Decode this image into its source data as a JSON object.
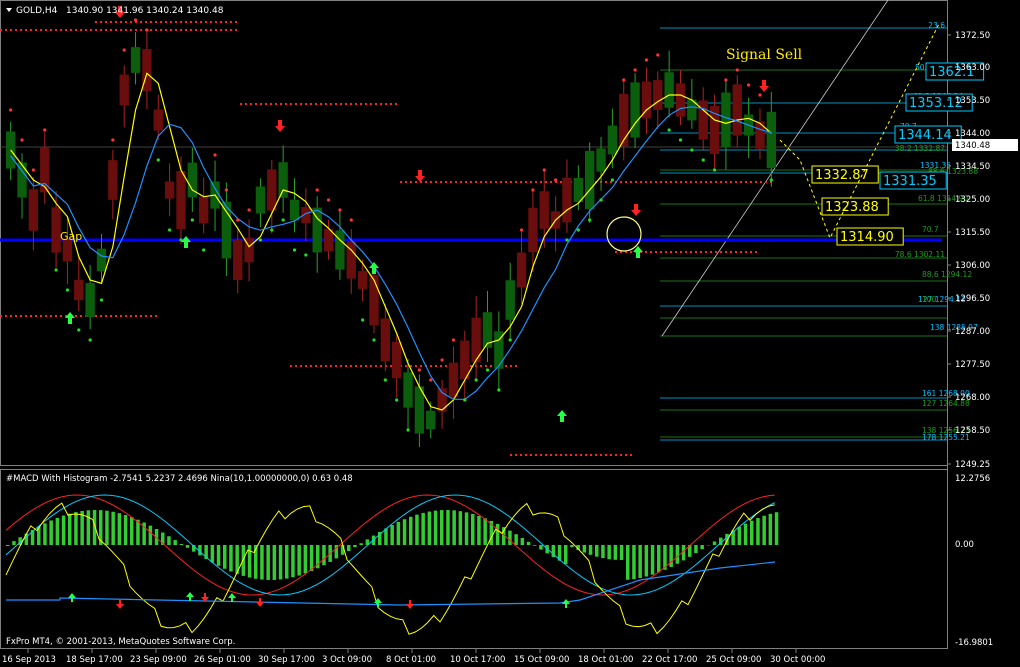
{
  "header": {
    "symbol": "GOLD,H4",
    "ohlc": "1340.90 1341.96 1340.24 1340.48"
  },
  "colors": {
    "background": "#000000",
    "bull_candle": "#0b5e0b",
    "bear_candle": "#6a0d0d",
    "ma_yellow": "#ffff00",
    "ma_cyan": "#1e90ff",
    "psar_green": "#22dd22",
    "psar_red": "#ff3333",
    "support_line": "#0000ff",
    "level_red": "#ff2222",
    "level_blue": "#3355ff",
    "fib_cyan": "#00bfff",
    "fib_green": "#1f9a1f",
    "annotation_yellow": "#ffee00"
  },
  "main_chart": {
    "annotations": {
      "signal_sell": "Signal Sell",
      "gap": "Gap"
    },
    "price_labels_boxed": [
      {
        "text": "1362.1",
        "color": "#00ccff"
      },
      {
        "text": "1353.12",
        "color": "#00ccff"
      },
      {
        "text": "1344.14",
        "color": "#00ccff"
      },
      {
        "text": "1332.87",
        "color": "#ffff00"
      },
      {
        "text": "1331.35",
        "color": "#00ccff"
      },
      {
        "text": "1323.88",
        "color": "#ffff00"
      },
      {
        "text": "1314.90",
        "color": "#ffff00"
      }
    ],
    "fib_labels": [
      {
        "text": "23.6",
        "color": "#00bfff"
      },
      {
        "text": "50.0  1353.12",
        "color": "#00bfff"
      },
      {
        "text": "61.8  1344.14",
        "color": "#00bfff"
      },
      {
        "text": "70.7",
        "color": "#00bfff"
      },
      {
        "text": "38.2  1332.87",
        "color": "#1f9a1f"
      },
      {
        "text": "1331.35",
        "color": "#00bfff"
      },
      {
        "text": "88.6  1323.88",
        "color": "#1f9a1f"
      },
      {
        "text": "61.8  1314.90",
        "color": "#1f9a1f"
      },
      {
        "text": "70.7",
        "color": "#1f9a1f"
      },
      {
        "text": "78.6  1302.11",
        "color": "#1f9a1f"
      },
      {
        "text": "88.6  1294.12",
        "color": "#1f9a1f"
      },
      {
        "text": "127   1294.12",
        "color": "#00bfff"
      },
      {
        "text": "100",
        "color": "#1f9a1f"
      },
      {
        "text": "138   1285.97",
        "color": "#00bfff"
      },
      {
        "text": "161   1268.00",
        "color": "#00bfff"
      },
      {
        "text": "127   1264.88",
        "color": "#1f9a1f"
      },
      {
        "text": "138   1256.23",
        "color": "#1f9a1f"
      },
      {
        "text": "178   1255.21",
        "color": "#00bfff"
      }
    ],
    "price_axis": {
      "ticks": [
        "1372.50",
        "1363.00",
        "1353.50",
        "1344.00",
        "1334.50",
        "1325.00",
        "1315.50",
        "1306.00",
        "1296.50",
        "1287.00",
        "1277.50",
        "1268.00",
        "1258.50",
        "1249.25"
      ],
      "current_price": "1340.48"
    }
  },
  "macd_panel": {
    "title": "#MACD With Histogram -2.7541 5.2237 2.4696  Nina(10,1.00000000,0) 0.63 0.48",
    "axis_ticks": [
      "12.2756",
      "0.00",
      "-16.9801"
    ]
  },
  "time_axis": {
    "labels": [
      "16 Sep 2013",
      "18 Sep 17:00",
      "23 Sep 09:00",
      "26 Sep 01:00",
      "30 Sep 17:00",
      "3 Oct 09:00",
      "8 Oct 01:00",
      "10 Oct 17:00",
      "15 Oct 09:00",
      "18 Oct 01:00",
      "22 Oct 17:00",
      "25 Oct 09:00",
      "30 Oct 00:00"
    ]
  },
  "copyright": "FxPro MT4, © 2001-2013, MetaQuotes Software Corp."
}
